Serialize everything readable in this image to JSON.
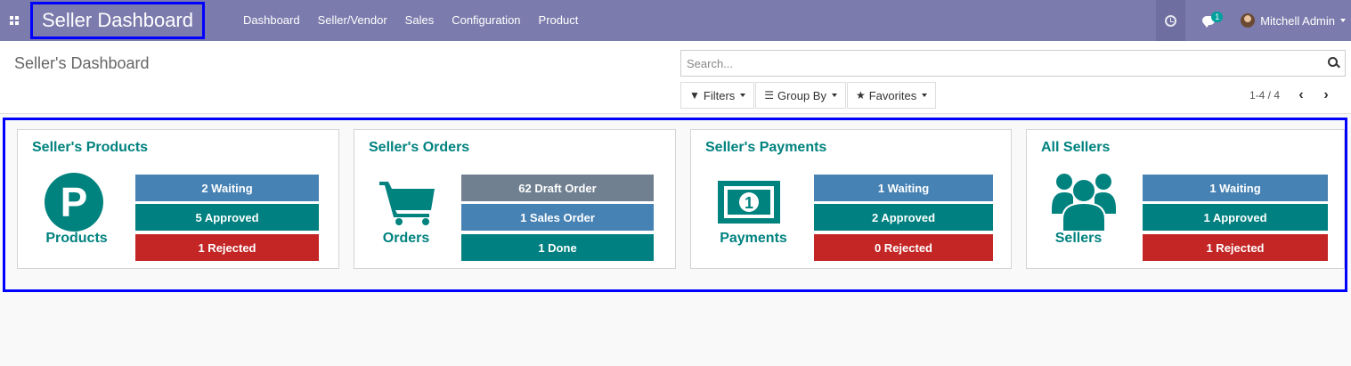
{
  "app": {
    "title": "Seller Dashboard"
  },
  "navbar": {
    "menu": [
      "Dashboard",
      "Seller/Vendor",
      "Sales",
      "Configuration",
      "Product"
    ],
    "chat_count": "1",
    "user_name": "Mitchell Admin"
  },
  "control_panel": {
    "title": "Seller's Dashboard",
    "search_placeholder": "Search...",
    "filters_label": "Filters",
    "group_by_label": "Group By",
    "favorites_label": "Favorites",
    "pager": "1-4 / 4"
  },
  "colors": {
    "accent": "#00827f",
    "navbar": "#7c7bad",
    "waiting": "#4682b4",
    "approved": "#008080",
    "rejected": "#c42525",
    "draft": "#708090"
  },
  "cards": [
    {
      "title": "Seller's Products",
      "icon": "product-p-icon",
      "label": "Products",
      "stats": [
        "2 Waiting",
        "5 Approved",
        "1 Rejected"
      ]
    },
    {
      "title": "Seller's Orders",
      "icon": "shopping-cart-icon",
      "label": "Orders",
      "stats": [
        "62 Draft Order",
        "1 Sales Order",
        "1 Done"
      ]
    },
    {
      "title": "Seller's Payments",
      "icon": "money-icon",
      "label": "Payments",
      "stats": [
        "1 Waiting",
        "2 Approved",
        "0 Rejected"
      ]
    },
    {
      "title": "All Sellers",
      "icon": "users-icon",
      "label": "Sellers",
      "stats": [
        "1 Waiting",
        "1 Approved",
        "1 Rejected"
      ]
    }
  ]
}
